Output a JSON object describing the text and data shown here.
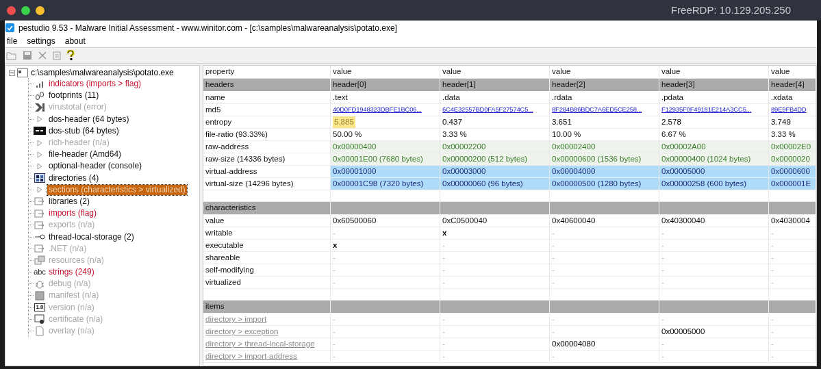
{
  "screen_title": "FreeRDP: 10.129.205.250",
  "window": {
    "title": "pestudio 9.53 - Malware Initial Assessment - www.winitor.com - [c:\\samples\\malwareanalysis\\potato.exe]",
    "checked": true
  },
  "menu": [
    "file",
    "settings",
    "about"
  ],
  "toolbar": [
    {
      "disabled": true
    },
    {
      "disabled": true
    },
    {
      "disabled": true
    },
    {
      "disabled": true
    },
    {
      "disabled": false
    }
  ],
  "tree": {
    "label": "c:\\samples\\malwareanalysis\\potato.exe",
    "expanded": true,
    "children": [
      {
        "label": "indicators (imports > flag)",
        "color": "#c8102e",
        "selected": false
      },
      {
        "label": "footprints (11)",
        "color": "#111111",
        "selected": false
      },
      {
        "label": "virustotal (error)",
        "color": "#a8a8a8",
        "selected": false
      },
      {
        "label": "dos-header (64 bytes)",
        "color": "#111111",
        "selected": false
      },
      {
        "label": "dos-stub (64 bytes)",
        "color": "#111111",
        "selected": false
      },
      {
        "label": "rich-header (n/a)",
        "color": "#a8a8a8",
        "selected": false
      },
      {
        "label": "file-header (Amd64)",
        "color": "#111111",
        "selected": false
      },
      {
        "label": "optional-header (console)",
        "color": "#111111",
        "selected": false
      },
      {
        "label": "directories (4)",
        "color": "#111111",
        "selected": false
      },
      {
        "label": "sections (characteristics > virtualized)",
        "selected": true
      },
      {
        "label": "libraries (2)",
        "color": "#111111",
        "selected": false
      },
      {
        "label": "imports (flag)",
        "color": "#c8102e",
        "selected": false
      },
      {
        "label": "exports (n/a)",
        "color": "#a8a8a8",
        "selected": false
      },
      {
        "label": "thread-local-storage (2)",
        "color": "#111111",
        "selected": false
      },
      {
        "label": ".NET (n/a)",
        "color": "#a8a8a8",
        "selected": false
      },
      {
        "label": "resources (n/a)",
        "color": "#a8a8a8",
        "selected": false
      },
      {
        "label": "strings (249)",
        "color": "#c8102e",
        "selected": false,
        "icon_text": "abc"
      },
      {
        "label": "debug (n/a)",
        "color": "#a8a8a8",
        "selected": false
      },
      {
        "label": "manifest (n/a)",
        "color": "#a8a8a8",
        "selected": false
      },
      {
        "label": "version (n/a)",
        "color": "#a8a8a8",
        "selected": false,
        "icon_text": "1.0"
      },
      {
        "label": "certificate (n/a)",
        "color": "#a8a8a8",
        "selected": false
      },
      {
        "label": "overlay (n/a)",
        "color": "#a8a8a8",
        "selected": false
      }
    ]
  },
  "table": {
    "columns": [
      "property",
      "value",
      "value",
      "value",
      "value",
      "value"
    ],
    "sections": [
      {
        "title": "headers",
        "cells": [
          "header[0]",
          "header[1]",
          "header[2]",
          "header[3]",
          "header[4]"
        ],
        "rows": [
          {
            "kind": "plain",
            "property": "name",
            "cells": [
              ".text",
              ".data",
              ".rdata",
              ".pdata",
              ".xdata"
            ]
          },
          {
            "kind": "hash",
            "property": "md5",
            "cells": [
              "40D0FD1948323DBFE1BC06...",
              "6C4E32557BD0FA5F27574C5...",
              "8F284B86BDC7A6ED5CE258...",
              "F12935F0F49181E214A3CC5...",
              "89E9FB4DD"
            ]
          },
          {
            "kind": "plain",
            "property": "entropy",
            "cells": [
              {
                "text": "5.885",
                "highlighted": true
              },
              {
                "text": "0.437",
                "highlighted": false
              },
              {
                "text": "3.651",
                "highlighted": false
              },
              {
                "text": "2.578",
                "highlighted": false
              },
              {
                "text": "3.749",
                "highlighted": false
              }
            ]
          },
          {
            "kind": "plain",
            "property": "file-ratio (93.33%)",
            "cells": [
              "50.00 %",
              "3.33 %",
              "10.00 %",
              "6.67 %",
              "3.33 %"
            ]
          },
          {
            "kind": "raw",
            "property": "raw-address",
            "cells": [
              "0x00000400",
              "0x00002200",
              "0x00002400",
              "0x00002A00",
              "0x00002E0"
            ]
          },
          {
            "kind": "raw",
            "property": "raw-size (14336 bytes)",
            "cells": [
              "0x00001E00 (7680 bytes)",
              "0x00000200 (512 bytes)",
              "0x00000600 (1536 bytes)",
              "0x00000400 (1024 bytes)",
              "0x0000020"
            ]
          },
          {
            "kind": "virtual",
            "property": "virtual-address",
            "cells": [
              "0x00001000",
              "0x00003000",
              "0x00004000",
              "0x00005000",
              "0x0000600"
            ]
          },
          {
            "kind": "virtual",
            "property": "virtual-size (14296 bytes)",
            "cells": [
              "0x00001C98 (7320 bytes)",
              "0x00000060 (96 bytes)",
              "0x00000500 (1280 bytes)",
              "0x00000258 (600 bytes)",
              "0x000001E"
            ]
          }
        ]
      },
      {
        "title": "characteristics",
        "rows": [
          {
            "kind": "plain",
            "property": "value",
            "cells": [
              "0x60500060",
              "0xC0500040",
              "0x40600040",
              "0x40300040",
              "0x4030004"
            ]
          },
          {
            "kind": "flag",
            "property": "writable",
            "cells": [
              {
                "text": "-",
                "empty": true
              },
              {
                "text": "x",
                "empty": false
              },
              {
                "text": "-",
                "empty": true
              },
              {
                "text": "-",
                "empty": true
              },
              {
                "text": "-",
                "empty": true
              }
            ]
          },
          {
            "kind": "flag",
            "property": "executable",
            "cells": [
              {
                "text": "x",
                "empty": false
              },
              {
                "text": "-",
                "empty": true
              },
              {
                "text": "-",
                "empty": true
              },
              {
                "text": "-",
                "empty": true
              },
              {
                "text": "-",
                "empty": true
              }
            ]
          },
          {
            "kind": "flag",
            "property": "shareable",
            "cells": [
              {
                "text": "-",
                "empty": true
              },
              {
                "text": "-",
                "empty": true
              },
              {
                "text": "-",
                "empty": true
              },
              {
                "text": "-",
                "empty": true
              },
              {
                "text": "-",
                "empty": true
              }
            ]
          },
          {
            "kind": "flag",
            "property": "self-modifying",
            "cells": [
              {
                "text": "-",
                "empty": true
              },
              {
                "text": "-",
                "empty": true
              },
              {
                "text": "-",
                "empty": true
              },
              {
                "text": "-",
                "empty": true
              },
              {
                "text": "-",
                "empty": true
              }
            ]
          },
          {
            "kind": "flag",
            "property": "virtualized",
            "cells": [
              {
                "text": "-",
                "empty": true
              },
              {
                "text": "-",
                "empty": true
              },
              {
                "text": "-",
                "empty": true
              },
              {
                "text": "-",
                "empty": true
              },
              {
                "text": "-",
                "empty": true
              }
            ]
          }
        ]
      },
      {
        "title": "items",
        "rows": [
          {
            "kind": "link",
            "property": "directory > import",
            "cells": [
              {
                "text": "-",
                "empty": true
              },
              {
                "text": "-",
                "empty": true
              },
              {
                "text": "-",
                "empty": true
              },
              {
                "text": "-",
                "empty": true
              },
              {
                "text": "-",
                "empty": true
              }
            ]
          },
          {
            "kind": "link",
            "property": "directory > exception",
            "cells": [
              {
                "text": "-",
                "empty": true
              },
              {
                "text": "-",
                "empty": true
              },
              {
                "text": "-",
                "empty": true
              },
              {
                "text": "0x00005000",
                "empty": false
              },
              {
                "text": "-",
                "empty": true
              }
            ]
          },
          {
            "kind": "link",
            "property": "directory > thread-local-storage",
            "cells": [
              {
                "text": "-",
                "empty": true
              },
              {
                "text": "-",
                "empty": true
              },
              {
                "text": "0x00004080",
                "empty": false
              },
              {
                "text": "-",
                "empty": true
              },
              {
                "text": "-",
                "empty": true
              }
            ]
          },
          {
            "kind": "link",
            "property": "directory > import-address",
            "cells": [
              {
                "text": "-",
                "empty": true
              },
              {
                "text": "-",
                "empty": true
              },
              {
                "text": "-",
                "empty": true
              },
              {
                "text": "-",
                "empty": true
              },
              {
                "text": "-",
                "empty": true
              }
            ]
          }
        ]
      }
    ]
  }
}
